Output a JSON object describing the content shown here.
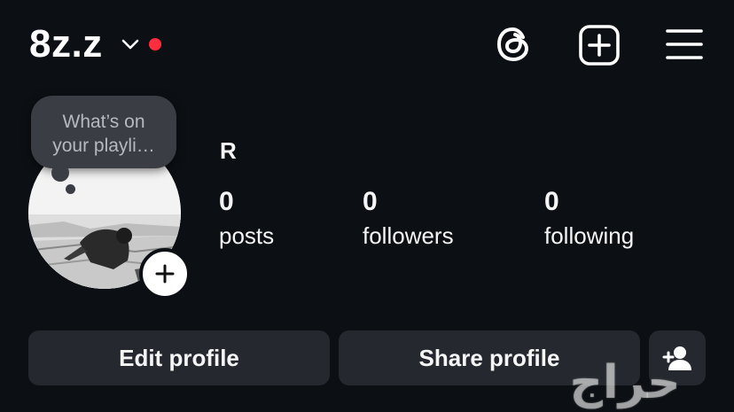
{
  "header": {
    "username": "8z.z",
    "notification_dot_color": "#ff2d3d",
    "icons": [
      "chevron-down-icon",
      "threads-icon",
      "create-post-icon",
      "menu-icon"
    ]
  },
  "profile": {
    "note_text_line1": "What’s on",
    "note_text_line2": "your playli…",
    "display_name": "R",
    "stats": {
      "posts_count": "0",
      "posts_label": "posts",
      "followers_count": "0",
      "followers_label": "followers",
      "following_count": "0",
      "following_label": "following"
    }
  },
  "actions": {
    "edit_label": "Edit profile",
    "share_label": "Share profile",
    "add_person_icon": "add-person-icon"
  },
  "watermark": {
    "text": "حراج"
  },
  "colors": {
    "background": "#0c0f14",
    "button_bg": "#25292f",
    "note_bg": "#3a3d43"
  }
}
